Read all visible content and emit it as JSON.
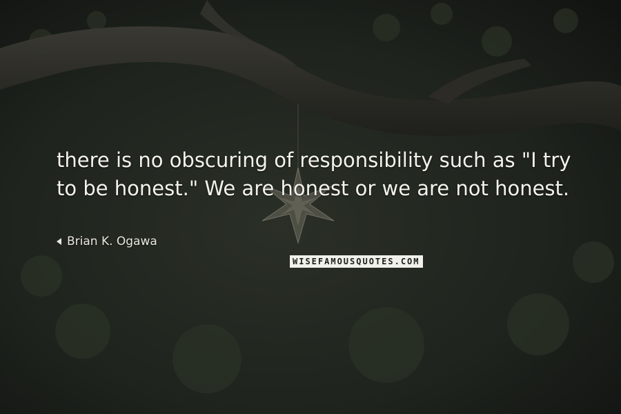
{
  "quote": {
    "text": "there is no obscuring of responsibility such as \"I try to be honest.\" We are honest or we are not honest."
  },
  "author": {
    "name": "Brian K. Ogawa"
  },
  "watermark": {
    "text": "WISEFAMOUSQUOTES.COM"
  },
  "colors": {
    "background": "#1b1e1a",
    "text": "#f4f2ec"
  },
  "icons": {
    "author_marker": "triangle-left-icon",
    "star_ornament": "star-ornament-icon"
  }
}
